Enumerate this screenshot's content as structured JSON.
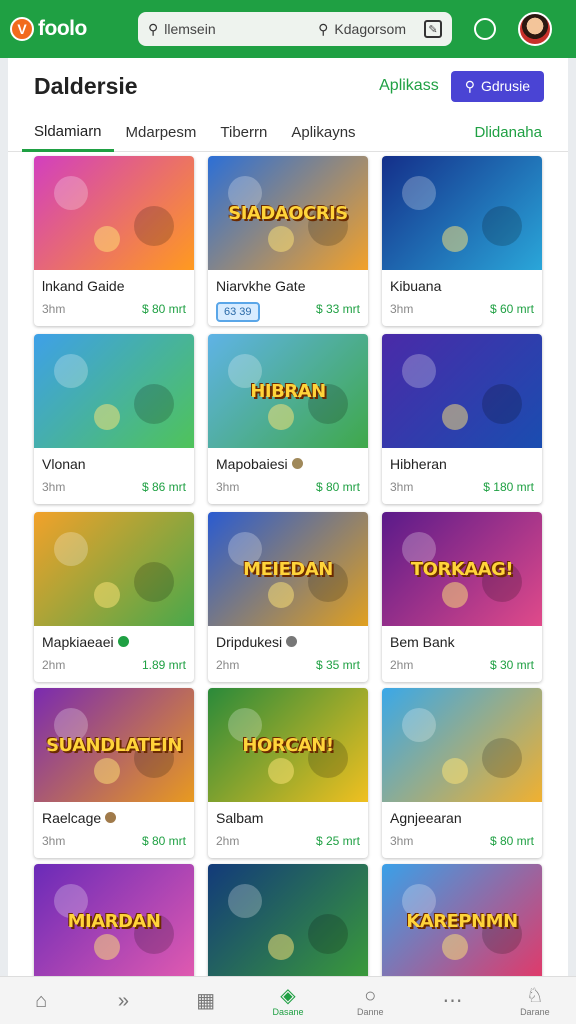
{
  "app": {
    "logo_letter": "V",
    "logo_text": "foolo"
  },
  "search": {
    "left_text": "llemsein",
    "right_text": "Kdagorsom"
  },
  "header": {
    "title": "Daldersie",
    "link": "Aplikass",
    "button": "Gdrusie"
  },
  "tabs": [
    "Sldamiarn",
    "Mdarpesm",
    "Tiberrn",
    "Aplikayns",
    "Dlidanaha"
  ],
  "cards": [
    {
      "name": "lnkand Gaide",
      "dur": "3hm",
      "price": "$ 80 mrt",
      "thumb_text": "",
      "c1": "#d23fbf",
      "c2": "#ff9a1f",
      "badge": null,
      "tag": null
    },
    {
      "name": "Niarvkhe Gate",
      "dur": "",
      "price": "$ 33 mrt",
      "thumb_text": "SIADAOCRIS",
      "c1": "#2c6fd6",
      "c2": "#f2a12a",
      "badge": null,
      "tag": "63 39"
    },
    {
      "name": "Kibuana",
      "dur": "3hm",
      "price": "$ 60 mrt",
      "thumb_text": "",
      "c1": "#142f8a",
      "c2": "#2aa6d9",
      "badge": null,
      "tag": null
    },
    {
      "name": "Vlonan",
      "dur": "3hm",
      "price": "$ 86 mrt",
      "thumb_text": "",
      "c1": "#3ea0e8",
      "c2": "#4fc35a",
      "badge": null,
      "tag": null
    },
    {
      "name": "Mapobaiesi",
      "dur": "3hm",
      "price": "$ 80 mrt",
      "thumb_text": "HIBRAN",
      "c1": "#5fb3e6",
      "c2": "#3fa84a",
      "badge": "#a0895a",
      "tag": null
    },
    {
      "name": "Hibheran",
      "dur": "3hm",
      "price": "$ 180 mrt",
      "thumb_text": "",
      "c1": "#4a2aa8",
      "c2": "#1a4db0",
      "badge": null,
      "tag": null
    },
    {
      "name": "Mapkiaeaei",
      "dur": "2hm",
      "price": "1.89 mrt",
      "thumb_text": "",
      "c1": "#f2a12a",
      "c2": "#4aa84a",
      "badge": "#1fa043",
      "tag": null
    },
    {
      "name": "Dripdukesi",
      "dur": "2hm",
      "price": "$ 35 mrt",
      "thumb_text": "MEIEDAN",
      "c1": "#2a5bd0",
      "c2": "#e0a020",
      "badge": "#777777",
      "tag": null
    },
    {
      "name": "Bem Bank",
      "dur": "2hm",
      "price": "$ 30 mrt",
      "thumb_text": "TORKAAG!",
      "c1": "#5a1a8a",
      "c2": "#e04a8a",
      "badge": null,
      "tag": null
    },
    {
      "name": "Raelcage",
      "dur": "3hm",
      "price": "$ 80 mrt",
      "thumb_text": "SUANDLATEIN",
      "c1": "#7a2ab0",
      "c2": "#e89a20",
      "badge": "#a07a4a",
      "tag": null
    },
    {
      "name": "Salbam",
      "dur": "2hm",
      "price": "$ 25 mrt",
      "thumb_text": "HORCAN!",
      "c1": "#2a8a3a",
      "c2": "#f0c020",
      "badge": null,
      "tag": null
    },
    {
      "name": "Agnjeearan",
      "dur": "3hm",
      "price": "$ 80 mrt",
      "thumb_text": "",
      "c1": "#3aa8e8",
      "c2": "#f0b030",
      "badge": null,
      "tag": null
    },
    {
      "name": "",
      "dur": "",
      "price": "",
      "thumb_text": "MIARDAN",
      "c1": "#6a2ab8",
      "c2": "#e05ab0",
      "badge": null,
      "tag": null
    },
    {
      "name": "",
      "dur": "",
      "price": "",
      "thumb_text": "",
      "c1": "#123a7a",
      "c2": "#3a9a3a",
      "badge": null,
      "tag": null
    },
    {
      "name": "",
      "dur": "",
      "price": "",
      "thumb_text": "KAREPNMN",
      "c1": "#3aa0e8",
      "c2": "#e03a6a",
      "badge": null,
      "tag": null
    }
  ],
  "bottom_nav": [
    {
      "icon": "⌂",
      "label": "",
      "active": false
    },
    {
      "icon": "»",
      "label": "",
      "active": false
    },
    {
      "icon": "▦",
      "label": "",
      "active": false
    },
    {
      "icon": "◈",
      "label": "Dasane",
      "active": true
    },
    {
      "icon": "○",
      "label": "Danne",
      "active": false
    },
    {
      "icon": "⋯",
      "label": "",
      "active": false
    },
    {
      "icon": "♘",
      "label": "Darane",
      "active": false
    }
  ]
}
